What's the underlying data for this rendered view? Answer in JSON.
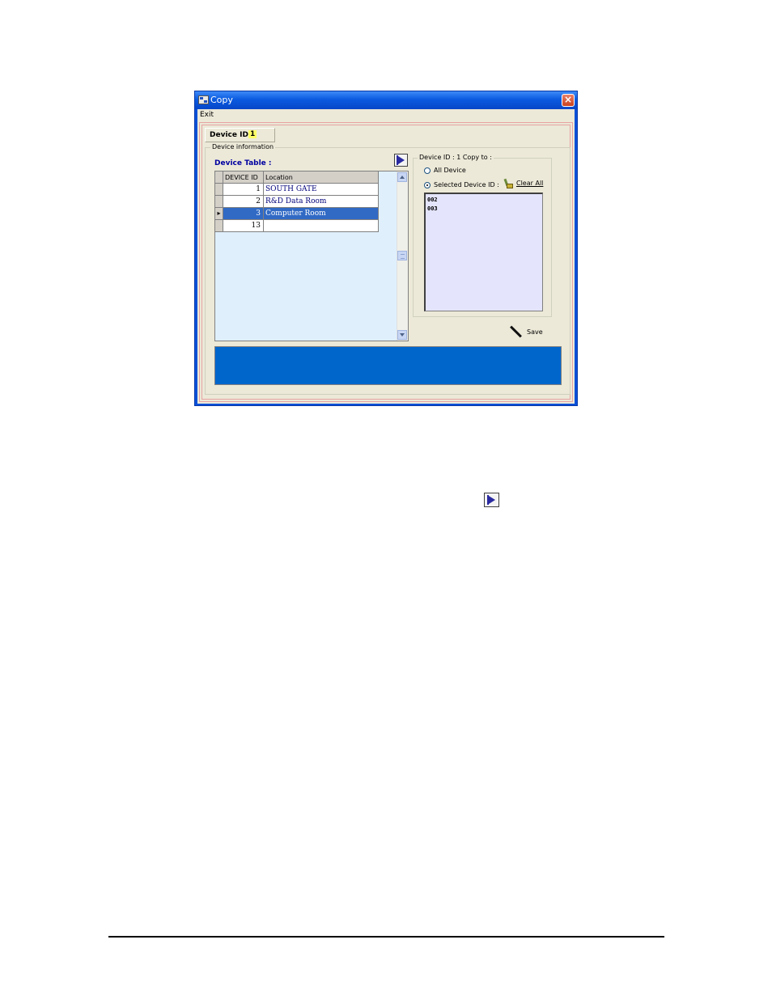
{
  "window": {
    "title": "Copy",
    "close_glyph": "×",
    "icon": "app-window-icon"
  },
  "menu": {
    "exit": "Exit"
  },
  "device_id": {
    "label": "Device ID :",
    "value": "1"
  },
  "device_info": {
    "legend": "Device information",
    "table_label": "Device Table :",
    "arrow_button_icon": "play-arrow-icon",
    "columns": [
      "DEVICE ID",
      "Location"
    ],
    "rows": [
      {
        "id": "1",
        "location": "SOUTH GATE",
        "selected": false,
        "indicator": ""
      },
      {
        "id": "2",
        "location": "R&D Data Room",
        "selected": false,
        "indicator": ""
      },
      {
        "id": "3",
        "location": "Computer Room",
        "selected": true,
        "indicator": "▸"
      },
      {
        "id": "13",
        "location": "",
        "selected": false,
        "indicator": ""
      }
    ]
  },
  "copy_to": {
    "legend": "Device ID : 1 Copy to :",
    "all_device_label": "All Device",
    "selected_device_label": "Selected Device ID :",
    "selected_option": "Selected Device ID",
    "clear_all_label": "Clear All",
    "clear_all_icon": "broom-icon",
    "selected_ids": [
      "002",
      "003"
    ]
  },
  "save": {
    "label": "Save",
    "icon": "pen-icon"
  },
  "colors": {
    "status_panel": "#0066cc",
    "selected_row": "#316ac5",
    "grid_background": "#dff0fc",
    "list_background": "#e4e4fc",
    "device_id_highlight": "#ffff66"
  }
}
